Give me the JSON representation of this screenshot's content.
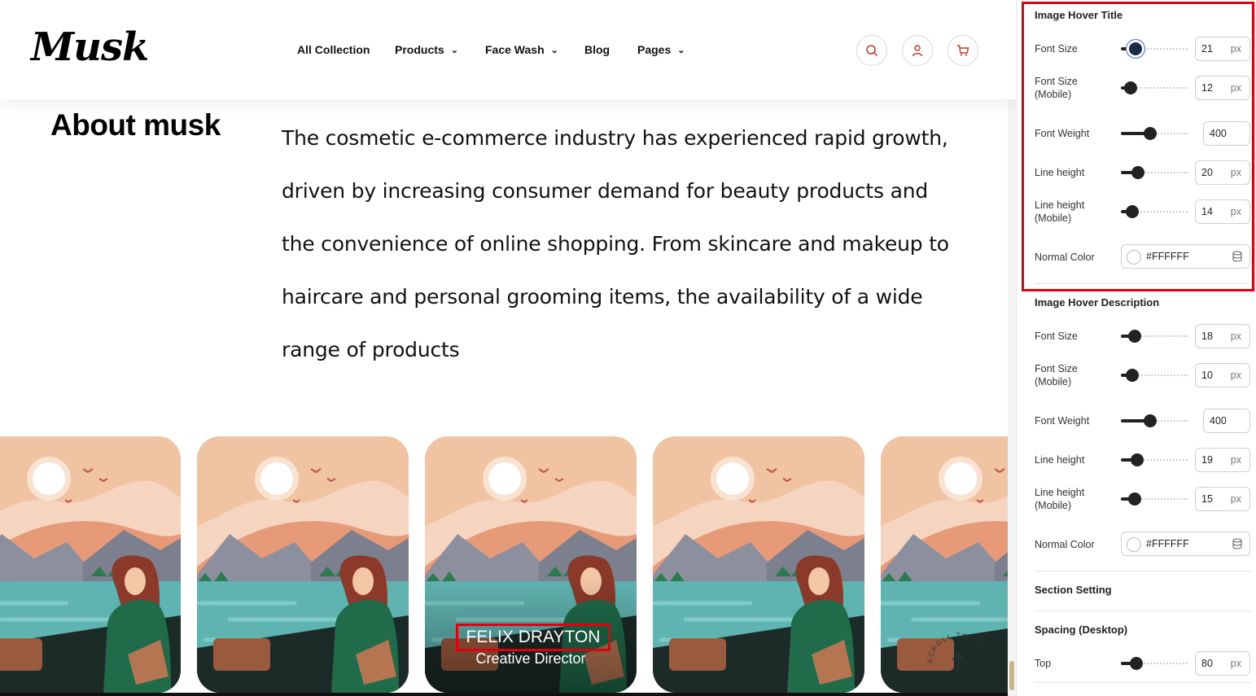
{
  "site": {
    "logo": "Musk",
    "nav": [
      {
        "label": "All Collection",
        "dropdown": false
      },
      {
        "label": "Products",
        "dropdown": true
      },
      {
        "label": "Face Wash",
        "dropdown": true
      },
      {
        "label": "Blog",
        "dropdown": false
      },
      {
        "label": "Pages",
        "dropdown": true
      }
    ],
    "icons": [
      "search-icon",
      "user-icon",
      "cart-icon"
    ],
    "about_title": "About musk",
    "about_text": "The cosmetic e-commerce industry has experienced rapid growth, driven by increasing consumer demand for beauty products and the convenience of online shopping. From skincare and makeup to haircare and personal grooming items, the availability of a wide range of products",
    "team_card_hover": {
      "title": "FELIX DRAYTON",
      "description": "Creative Director"
    },
    "scroll_badge": "SCROLL TO TOP"
  },
  "panel": {
    "hover_title_section": {
      "title": "Image Hover Title",
      "font_size": {
        "label": "Font Size",
        "value": "21",
        "unit": "px"
      },
      "font_size_mobile": {
        "label": "Font Size\n(Mobile)",
        "value": "12",
        "unit": "px"
      },
      "font_weight": {
        "label": "Font Weight",
        "value": "400"
      },
      "line_height": {
        "label": "Line height",
        "value": "20",
        "unit": "px"
      },
      "line_height_mobile": {
        "label": "Line height\n(Mobile)",
        "value": "14",
        "unit": "px"
      },
      "normal_color": {
        "label": "Normal Color",
        "value": "#FFFFFF"
      }
    },
    "hover_desc_section": {
      "title": "Image Hover Description",
      "font_size": {
        "label": "Font Size",
        "value": "18",
        "unit": "px"
      },
      "font_size_mobile": {
        "label": "Font Size\n(Mobile)",
        "value": "10",
        "unit": "px"
      },
      "font_weight": {
        "label": "Font Weight",
        "value": "400"
      },
      "line_height": {
        "label": "Line height",
        "value": "19",
        "unit": "px"
      },
      "line_height_mobile": {
        "label": "Line height\n(Mobile)",
        "value": "15",
        "unit": "px"
      },
      "normal_color": {
        "label": "Normal Color",
        "value": "#FFFFFF"
      }
    },
    "section_setting": "Section Setting",
    "spacing_desktop": "Spacing (Desktop)",
    "top": {
      "label": "Top",
      "value": "80",
      "unit": "px"
    }
  },
  "colors": {
    "highlight": "#e00010",
    "sky": "#f0c3a2",
    "water": "#5fb3b0",
    "hair": "#8b3a2a",
    "sweater": "#1f6b4a"
  }
}
